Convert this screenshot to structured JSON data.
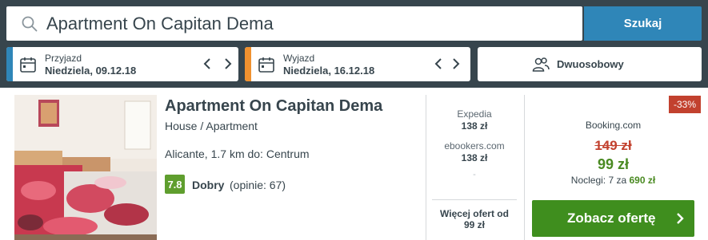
{
  "search": {
    "query": "Apartment On Capitan Dema",
    "button_label": "Szukaj"
  },
  "checkin": {
    "label": "Przyjazd",
    "value": "Niedziela, 09.12.18",
    "accent_color": "#2f86b8"
  },
  "checkout": {
    "label": "Wyjazd",
    "value": "Niedziela, 16.12.18",
    "accent_color": "#f0912f"
  },
  "room": {
    "label": "Dwuosobowy"
  },
  "hotel": {
    "name": "Apartment On Capitan Dema",
    "type": "House / Apartment",
    "location": "Alicante, 1.7 km do: Centrum",
    "rating_score": "7.8",
    "rating_word": "Dobry",
    "rating_count": "(opinie: 67)"
  },
  "other_offers": [
    {
      "provider": "Expedia",
      "price": "138 zł"
    },
    {
      "provider": "ebookers.com",
      "price": "138 zł"
    }
  ],
  "other_offers_dash": "-",
  "more_offers": {
    "line1": "Więcej ofert od",
    "line2": "99 zł"
  },
  "best_offer": {
    "discount": "-33%",
    "provider": "Booking.com",
    "old_price": "149 zł",
    "new_price": "99 zł",
    "nights_text": "Noclegi: 7 za",
    "nights_price": "690 zł",
    "cta_label": "Zobacz ofertę"
  },
  "colors": {
    "topbar": "#37454d",
    "primary": "#2f86b8",
    "green": "#3f8e1e",
    "discount": "#c2412e"
  }
}
